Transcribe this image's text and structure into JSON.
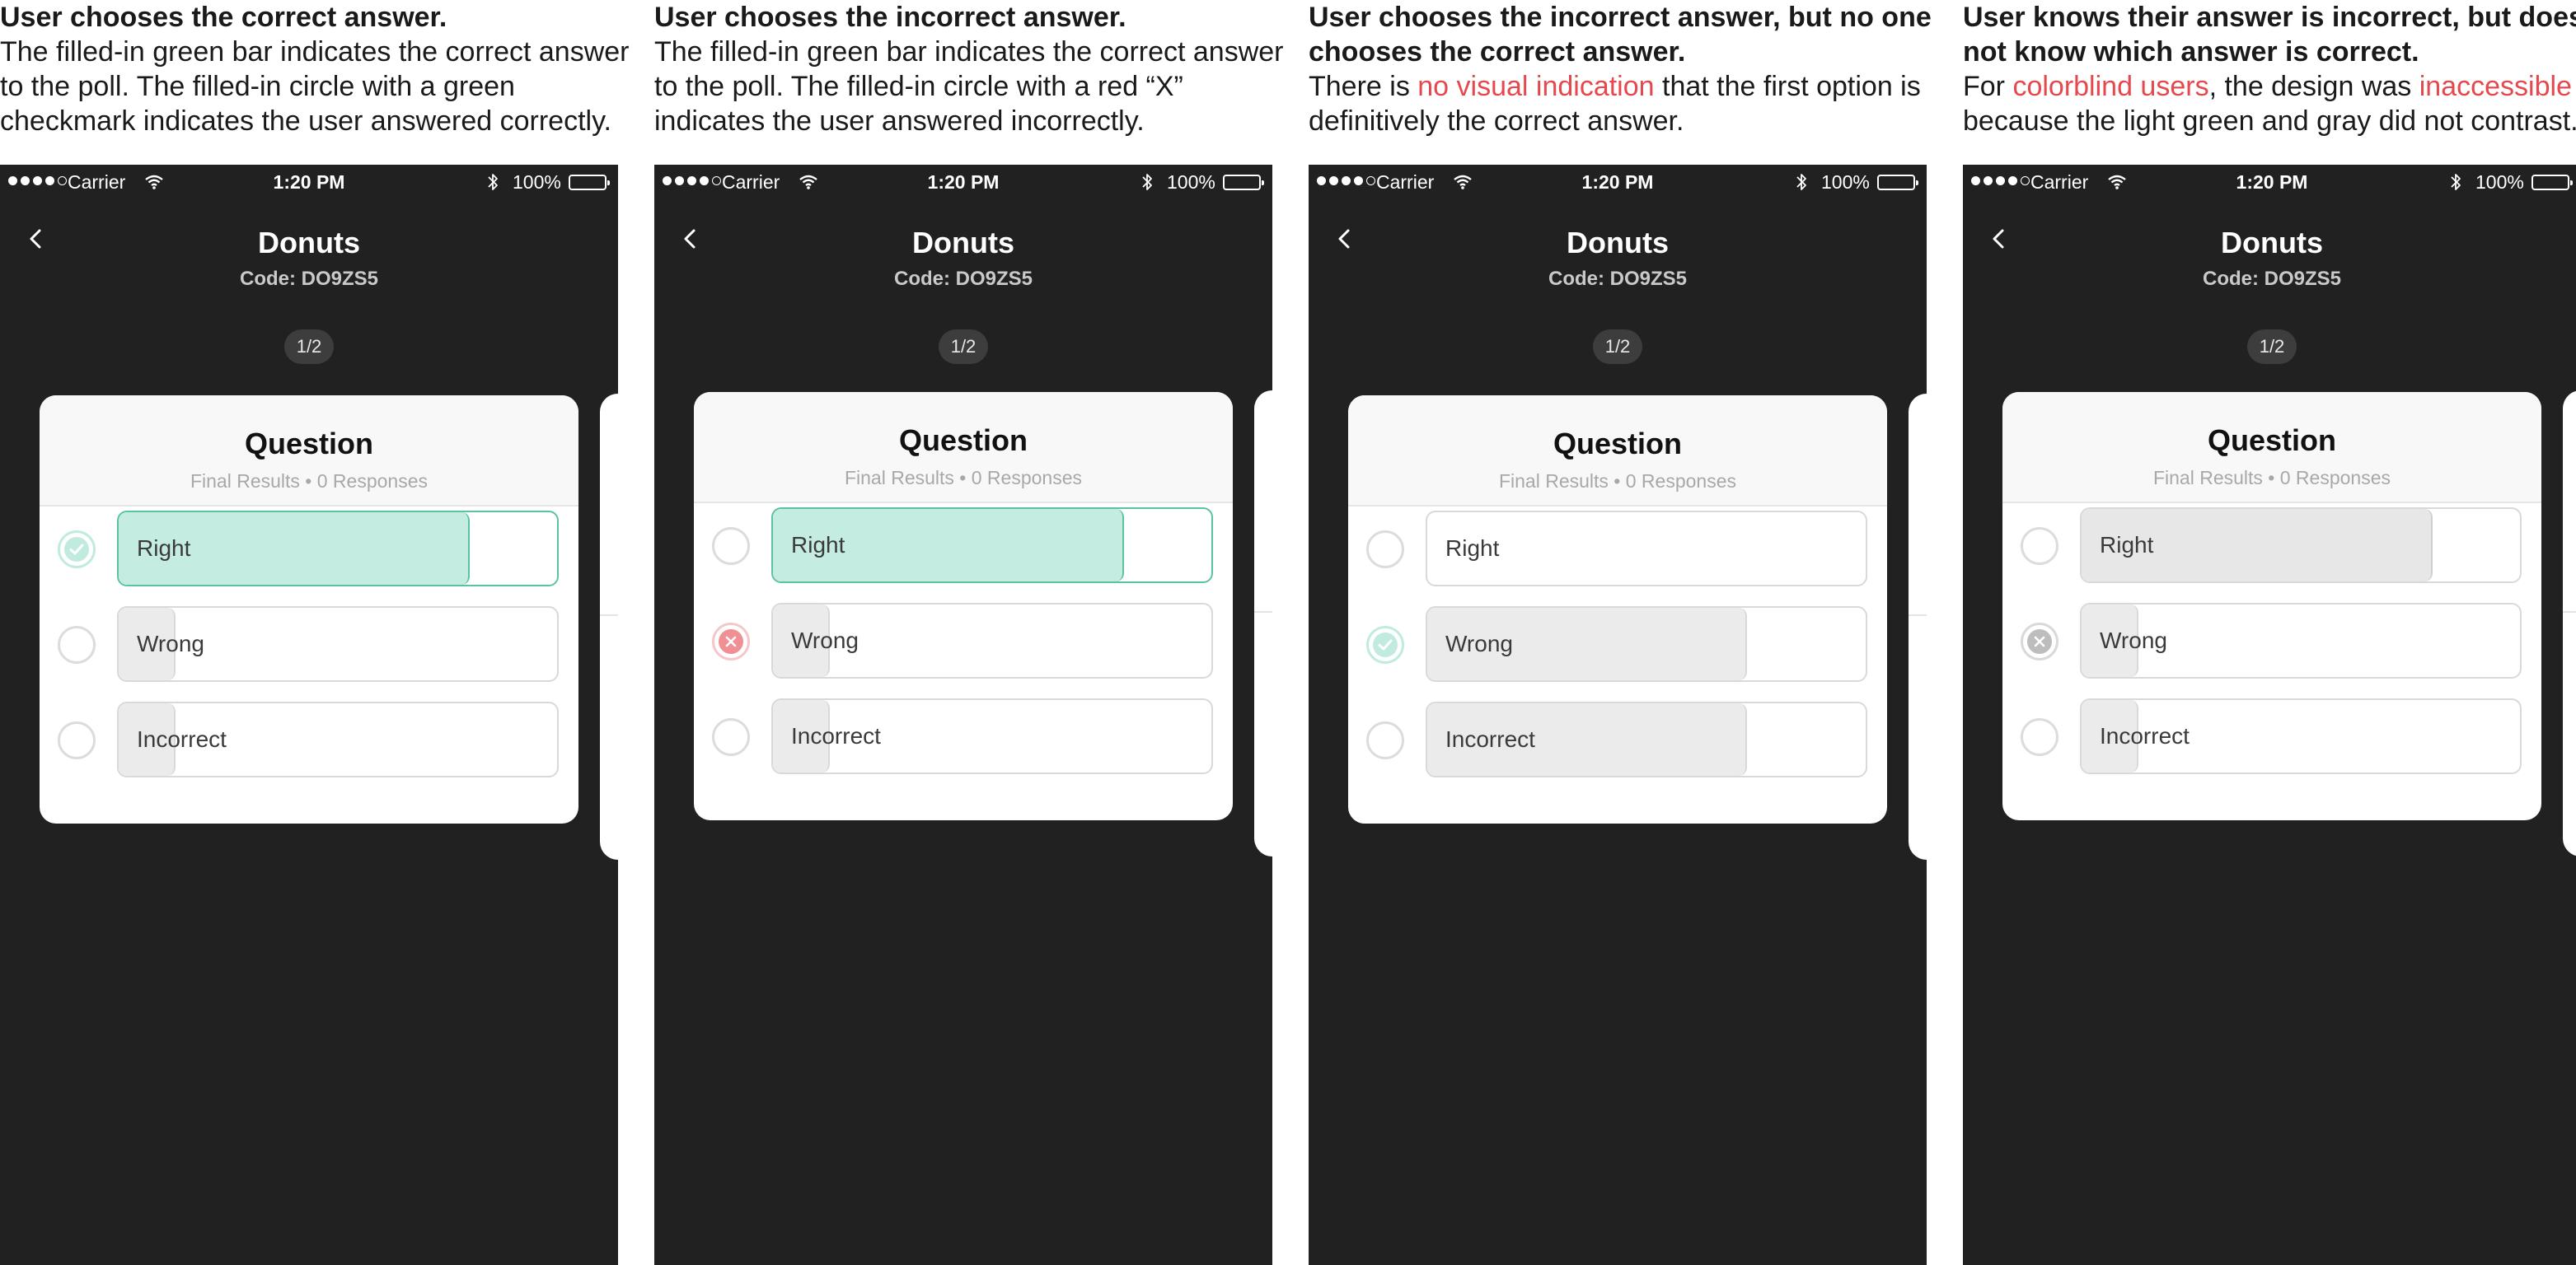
{
  "panels": [
    {
      "caption": {
        "title": "User chooses the correct answer.",
        "segments": [
          {
            "text": "The filled-in green bar indicates the correct answer to the poll. The filled-in circle with a green checkmark indicates the user answered correctly.",
            "highlight": false
          }
        ]
      },
      "status": {
        "carrier": "Carrier",
        "time": "1:20 PM",
        "battery": "100%"
      },
      "title": "Donuts",
      "code": "Code: DO9ZS5",
      "pager": "1/2",
      "question": "Question",
      "results": "Final Results • 0 Responses",
      "options": [
        {
          "label": "Right",
          "fill": 0.8,
          "fill_style": "green",
          "radio": "check-green"
        },
        {
          "label": "Wrong",
          "fill": 0.13,
          "fill_style": "neutral",
          "radio": "empty"
        },
        {
          "label": "Incorrect",
          "fill": 0.13,
          "fill_style": "neutral",
          "radio": "empty"
        }
      ]
    },
    {
      "caption": {
        "title": "User chooses the incorrect answer.",
        "segments": [
          {
            "text": "The filled-in green bar indicates the correct answer to the poll. The filled-in circle with a red “X” indicates the user answered incorrectly.",
            "highlight": false
          }
        ]
      },
      "status": {
        "carrier": "Carrier",
        "time": "1:20 PM",
        "battery": "100%"
      },
      "title": "Donuts",
      "code": "Code: DO9ZS5",
      "pager": "1/2",
      "question": "Question",
      "results": "Final Results • 0 Responses",
      "options": [
        {
          "label": "Right",
          "fill": 0.8,
          "fill_style": "green",
          "radio": "empty"
        },
        {
          "label": "Wrong",
          "fill": 0.13,
          "fill_style": "neutral",
          "radio": "x-red"
        },
        {
          "label": "Incorrect",
          "fill": 0.13,
          "fill_style": "neutral",
          "radio": "empty"
        }
      ]
    },
    {
      "caption": {
        "title": "User chooses the incorrect answer, but no one chooses the correct answer.",
        "segments": [
          {
            "text": "There is ",
            "highlight": false
          },
          {
            "text": "no visual indication",
            "highlight": true
          },
          {
            "text": " that the first option is definitively the correct answer.",
            "highlight": false
          }
        ]
      },
      "status": {
        "carrier": "Carrier",
        "time": "1:20 PM",
        "battery": "100%"
      },
      "title": "Donuts",
      "code": "Code: DO9ZS5",
      "pager": "1/2",
      "question": "Question",
      "results": "Final Results • 0 Responses",
      "options": [
        {
          "label": "Right",
          "fill": 0,
          "fill_style": "neutral",
          "radio": "empty"
        },
        {
          "label": "Wrong",
          "fill": 0.73,
          "fill_style": "neutral",
          "radio": "check-green"
        },
        {
          "label": "Incorrect",
          "fill": 0.73,
          "fill_style": "neutral",
          "radio": "empty"
        }
      ]
    },
    {
      "caption": {
        "title": "User knows their answer is incorrect, but does not know which answer is correct.",
        "segments": [
          {
            "text": "For ",
            "highlight": false
          },
          {
            "text": "colorblind users",
            "highlight": true
          },
          {
            "text": ", the design was ",
            "highlight": false
          },
          {
            "text": "inaccessible",
            "highlight": true
          },
          {
            "text": " because the light green and gray did not contrast.",
            "highlight": false
          }
        ]
      },
      "status": {
        "carrier": "Carrier",
        "time": "1:20 PM",
        "battery": "100%"
      },
      "title": "Donuts",
      "code": "Code: DO9ZS5",
      "pager": "1/2",
      "question": "Question",
      "results": "Final Results • 0 Responses",
      "options": [
        {
          "label": "Right",
          "fill": 0.8,
          "fill_style": "gray",
          "radio": "empty"
        },
        {
          "label": "Wrong",
          "fill": 0.13,
          "fill_style": "neutral",
          "radio": "x-gray"
        },
        {
          "label": "Incorrect",
          "fill": 0.13,
          "fill_style": "neutral",
          "radio": "empty"
        }
      ]
    }
  ],
  "colors": {
    "highlight": "#e5484d",
    "correct_fill": "#c5ece1",
    "correct_border": "#5ac3a4",
    "incorrect_mark": "#f08f94",
    "background": "#212121"
  }
}
